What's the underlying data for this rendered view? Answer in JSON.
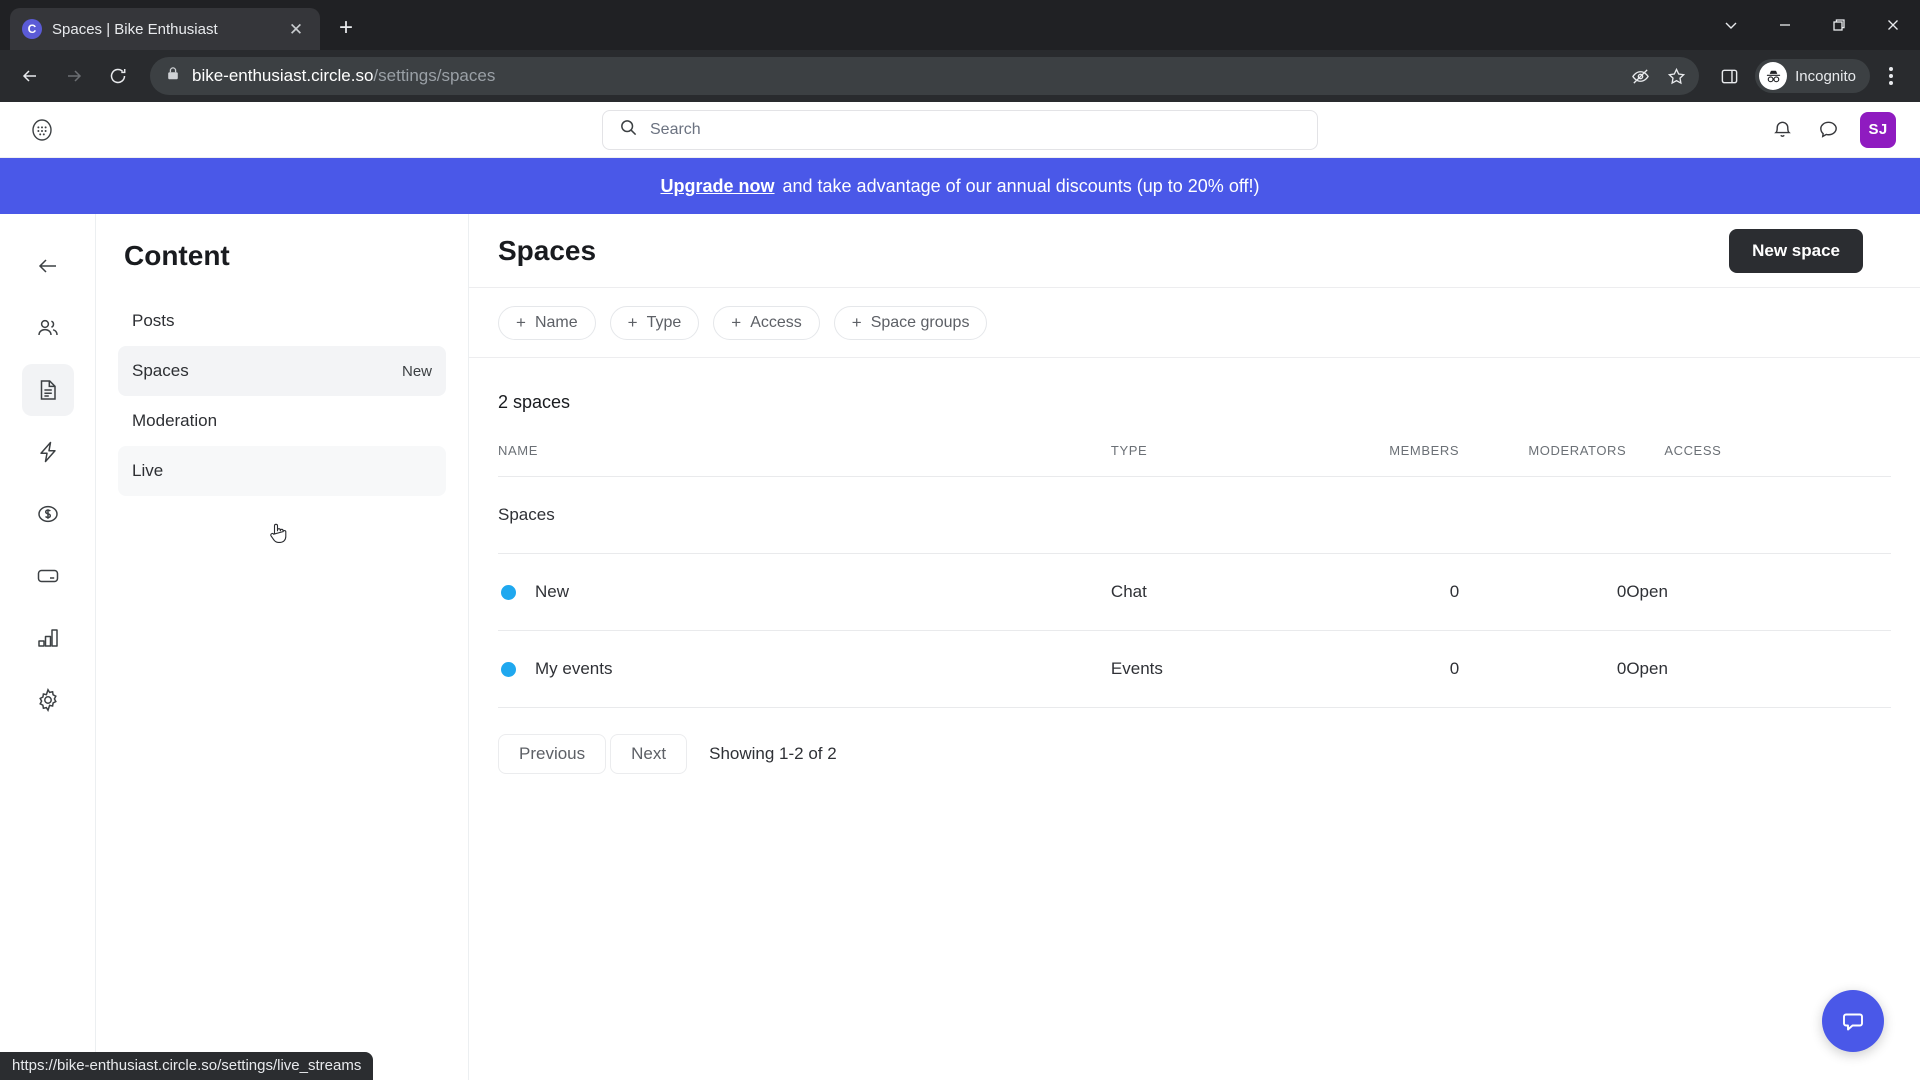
{
  "browser": {
    "tab": {
      "title": "Spaces | Bike Enthusiast",
      "favicon_letter": "C",
      "close_glyph": "✕"
    },
    "new_tab_glyph": "+",
    "window_controls": [
      {
        "name": "tab-search",
        "glyph": "⌄"
      },
      {
        "name": "minimize",
        "glyph": "—"
      },
      {
        "name": "maximize",
        "glyph": "❐"
      },
      {
        "name": "close",
        "glyph": "✕"
      }
    ],
    "nav": {
      "back": "←",
      "forward": "→",
      "reload": "⟳"
    },
    "omnibox": {
      "host": "bike-enthusiast.circle.so",
      "path": "/settings/spaces",
      "lock_icon": "lock-icon"
    },
    "toolbar_icons": [
      "third-party-cookie-blocked-icon",
      "bookmark-star-icon",
      "side-panel-icon"
    ],
    "profile": {
      "label": "Incognito"
    },
    "menu": "chrome-menu-icon"
  },
  "app": {
    "logo": "community-switcher-icon",
    "search": {
      "placeholder": "Search",
      "value": ""
    },
    "header_icons": [
      "notifications-bell-icon",
      "messages-bubble-icon"
    ],
    "avatar_initials": "SJ"
  },
  "banner": {
    "link_text": "Upgrade now",
    "rest_text": "and take advantage of our annual discounts (up to 20% off!)",
    "background": "#4a58e8"
  },
  "rail": [
    {
      "name": "back",
      "icon": "arrow-left-icon",
      "active": false
    },
    {
      "name": "members",
      "icon": "people-icon",
      "active": false
    },
    {
      "name": "content",
      "icon": "document-icon",
      "active": true
    },
    {
      "name": "automations",
      "icon": "lightning-bolt-icon",
      "active": false
    },
    {
      "name": "monetization",
      "icon": "dollar-circle-icon",
      "active": false
    },
    {
      "name": "billing",
      "icon": "credit-card-icon",
      "active": false
    },
    {
      "name": "analytics",
      "icon": "bar-chart-icon",
      "active": false
    },
    {
      "name": "settings",
      "icon": "gear-icon",
      "active": false
    }
  ],
  "sidebar": {
    "title": "Content",
    "items": [
      {
        "label": "Posts",
        "badge": "",
        "state": ""
      },
      {
        "label": "Spaces",
        "badge": "New",
        "state": "active"
      },
      {
        "label": "Moderation",
        "badge": "",
        "state": ""
      },
      {
        "label": "Live",
        "badge": "",
        "state": "hover"
      }
    ]
  },
  "main": {
    "title": "Spaces",
    "new_space_label": "New space",
    "filters": [
      {
        "plus": "+",
        "label": "Name"
      },
      {
        "plus": "+",
        "label": "Type"
      },
      {
        "plus": "+",
        "label": "Access"
      },
      {
        "plus": "+",
        "label": "Space groups"
      }
    ],
    "count_label": "2 spaces",
    "columns": [
      "NAME",
      "TYPE",
      "MEMBERS",
      "MODERATORS",
      "ACCESS"
    ],
    "group_label": "Spaces",
    "rows": [
      {
        "name": "New",
        "dot_color": "#1fa8ef",
        "type": "Chat",
        "members": "0",
        "moderators": "0",
        "access": "Open"
      },
      {
        "name": "My events",
        "dot_color": "#1fa8ef",
        "type": "Events",
        "members": "0",
        "moderators": "0",
        "access": "Open"
      }
    ],
    "pagination": {
      "previous": "Previous",
      "next": "Next",
      "showing": "Showing 1-2 of 2"
    },
    "fab_icon": "chat-bubble-icon"
  },
  "status_bar": {
    "url": "https://bike-enthusiast.circle.so/settings/live_streams"
  }
}
